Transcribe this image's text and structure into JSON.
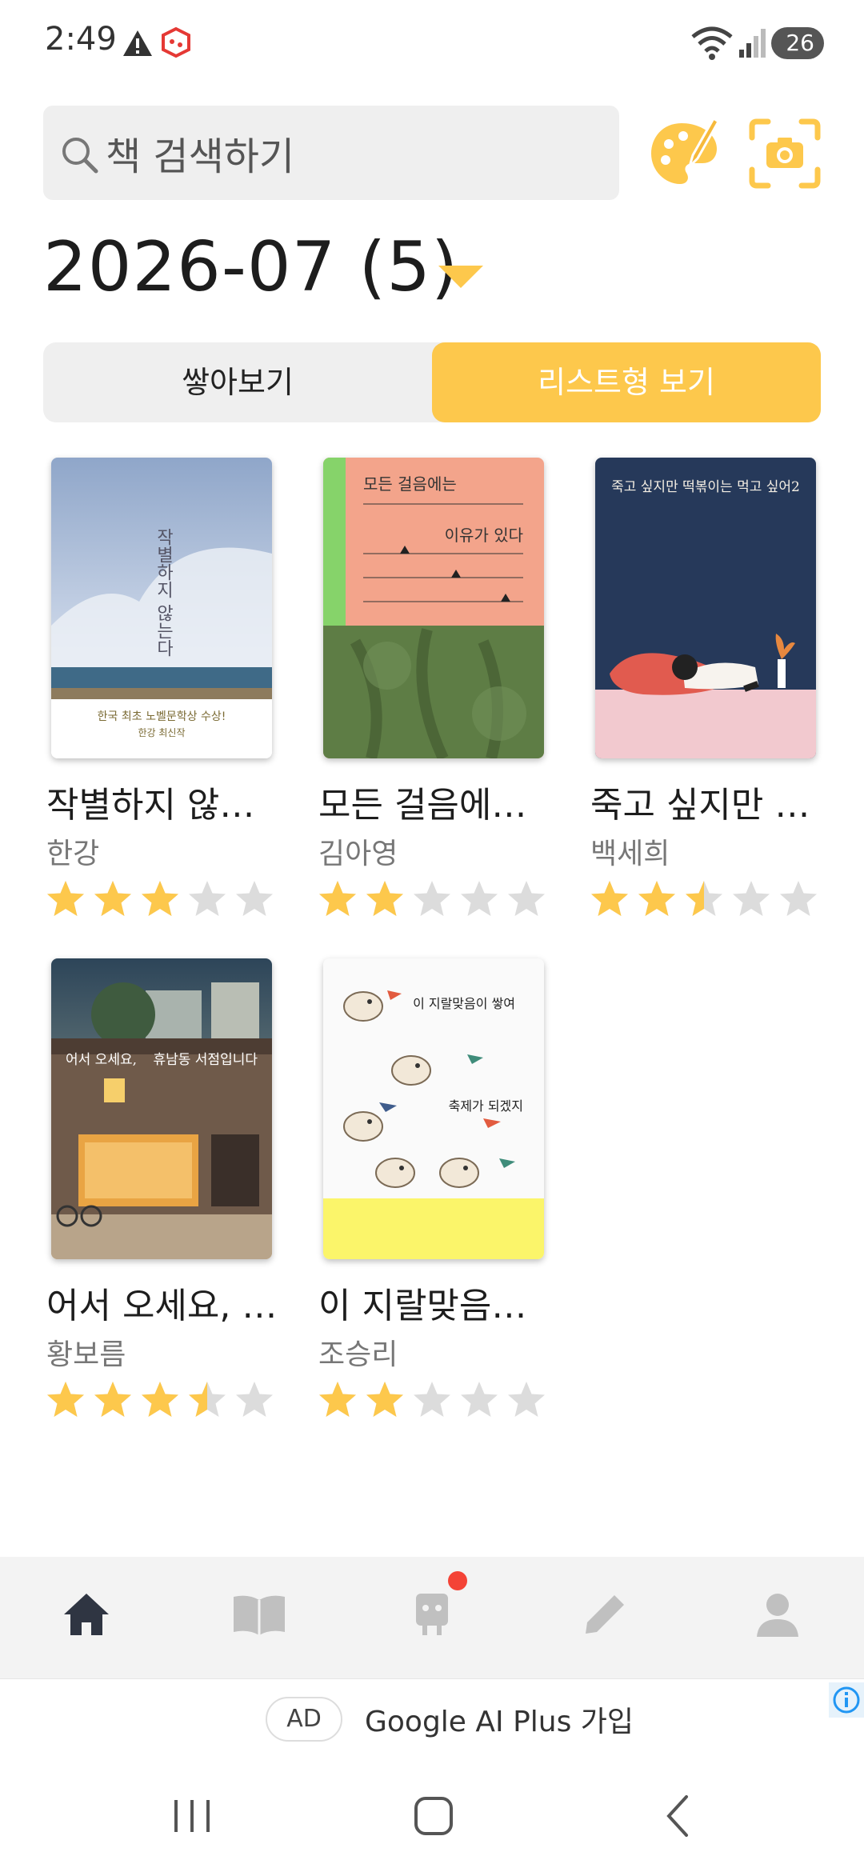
{
  "status_bar": {
    "time": "2:49",
    "battery": "26"
  },
  "search": {
    "placeholder": "책 검색하기"
  },
  "month": {
    "label": "2026-07 (5)"
  },
  "view_tabs": {
    "stack": "쌓아보기",
    "list": "리스트형 보기",
    "active": "list"
  },
  "books": [
    {
      "title": "작별하지 않는다",
      "author": "한강",
      "rating": 3.0
    },
    {
      "title": "모든 걸음에는 이유가 있다",
      "author": "김아영",
      "rating": 2.0
    },
    {
      "title": "죽고 싶지만 떡볶이는 먹고 싶어 2",
      "author": "백세희",
      "rating": 2.5
    },
    {
      "title": "어서 오세요, 휴남동 서점입니다",
      "author": "황보름",
      "rating": 3.5
    },
    {
      "title": "이 지랄맞음이 쌓여 축제가 되겠지",
      "author": "조승리",
      "rating": 2.0
    }
  ],
  "covers": {
    "book1": {
      "vertical_title": "작별하지 않는다",
      "tag": "한국 최초 노벨문학상 수상!",
      "sub": "한강 최신작"
    },
    "book2": {
      "line1": "모든 걸음에는",
      "line2": "이유가 있다"
    },
    "book3": {
      "title": "죽고 싶지만 떡볶이는 먹고 싶어2"
    },
    "book4": {
      "line1": "어서 오세요,",
      "line2": "휴남동 서점입니다"
    },
    "book5": {
      "line1": "이 지랄맞음이 쌓여",
      "line2": "축제가 되겠지"
    }
  },
  "bottom_nav": {
    "items": [
      "home",
      "library",
      "bot",
      "write",
      "profile"
    ],
    "active": "home"
  },
  "ad": {
    "label": "AD",
    "text": "Google AI Plus 가입"
  },
  "colors": {
    "accent": "#fdc84c",
    "star_on": "#fdc84c",
    "star_off": "#dcdcdc",
    "nav_active": "#2f3542",
    "nav_inactive": "#c0c0c0"
  }
}
